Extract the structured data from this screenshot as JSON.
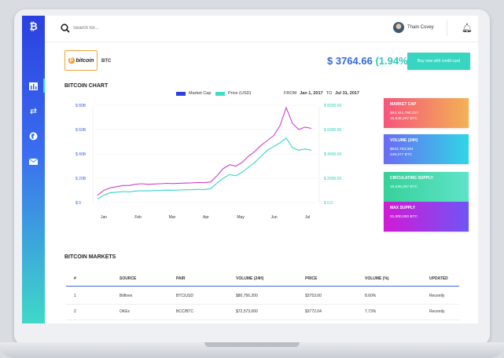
{
  "header": {
    "search_placeholder": "Search for...",
    "user_name": "Thain Covey"
  },
  "coin": {
    "logo_text": "bitcoin",
    "ticker": "BTC",
    "price": "$ 3764.66",
    "change": "(1.94%)",
    "buy_label": "Buy now with credit card"
  },
  "chart_section": {
    "title": "BITCOIN CHART",
    "legend_market_cap": "Market Cap",
    "legend_price": "Price (USD)",
    "from_label": "FROM",
    "from_date": "Jan 1, 2017",
    "to_label": "TO",
    "to_date": "Jul 31, 2017"
  },
  "chart_data": {
    "type": "line",
    "x_ticks": [
      "Jan",
      "Feb",
      "Mar",
      "Apr",
      "May",
      "Jun",
      "Jul"
    ],
    "y_left_ticks": [
      "$ 80B",
      "$ 60B",
      "$ 40B",
      "$ 20B",
      "$ 0"
    ],
    "y_right_ticks": [
      "$ 8000.00",
      "$ 6000.00",
      "$ 4000.00",
      "$ 2000.00",
      "$ 0.0"
    ],
    "y_left_range": [
      0,
      80
    ],
    "y_right_range": [
      0,
      8000
    ],
    "series": [
      {
        "name": "Market Cap",
        "color": "#cf3fd0",
        "axis": "left",
        "values": [
          6,
          10,
          12,
          13,
          14,
          14,
          15,
          15.5,
          15,
          15.2,
          15.5,
          15.8,
          15.6,
          15.9,
          16,
          16.2,
          16.5,
          16.3,
          17,
          22,
          28,
          31,
          30,
          33,
          38,
          42,
          47,
          51,
          55,
          63,
          78,
          65,
          60,
          62,
          61
        ]
      },
      {
        "name": "Price (USD)",
        "color": "#35d5c6",
        "axis": "right",
        "values": [
          300,
          600,
          800,
          850,
          900,
          880,
          950,
          970,
          960,
          980,
          1000,
          1020,
          1010,
          1030,
          1050,
          1060,
          1080,
          1070,
          1150,
          1600,
          2000,
          2300,
          2200,
          2500,
          2900,
          3300,
          3800,
          4300,
          4600,
          4900,
          5300,
          4500,
          4300,
          4400,
          4300
        ]
      }
    ],
    "grid": "horizontal",
    "legend": "top-center"
  },
  "stats": [
    {
      "title": "MARKET CAP",
      "line1": "$53,441,750,217",
      "line2": "15,535,287 BTC",
      "from": "#f6547c",
      "to": "#f3b255"
    },
    {
      "title": "VOLUME (24H)",
      "line1": "$934,763,094",
      "line2": "249,277 BTC",
      "from": "#6a6cf3",
      "to": "#2fd6e6"
    },
    {
      "title": "CIRCULATING SUPPLY",
      "line1": "15,536,287 BTC",
      "line2": "",
      "from": "#36d19a",
      "to": "#5fe3c8"
    },
    {
      "title": "MAX SUPPLY",
      "line1": "21,000,000 BTC",
      "line2": "",
      "from": "#d11ad6",
      "to": "#6f55f5"
    }
  ],
  "markets": {
    "title": "BITCOIN MARKETS",
    "headers": [
      "#",
      "SOURCE",
      "PAIR",
      "VOLUME (24H)",
      "PRICE",
      "VOLUME (%)",
      "UPDATED"
    ],
    "rows": [
      [
        "1",
        "Bitfinex",
        "BTC/USD",
        "$80,756,200",
        "$3753.00",
        "8.60%",
        "Recently"
      ],
      [
        "2",
        "OKEx",
        "BCC/BTC",
        "$72,573,000",
        "$3772.04",
        "7.73%",
        "Recently"
      ]
    ]
  }
}
